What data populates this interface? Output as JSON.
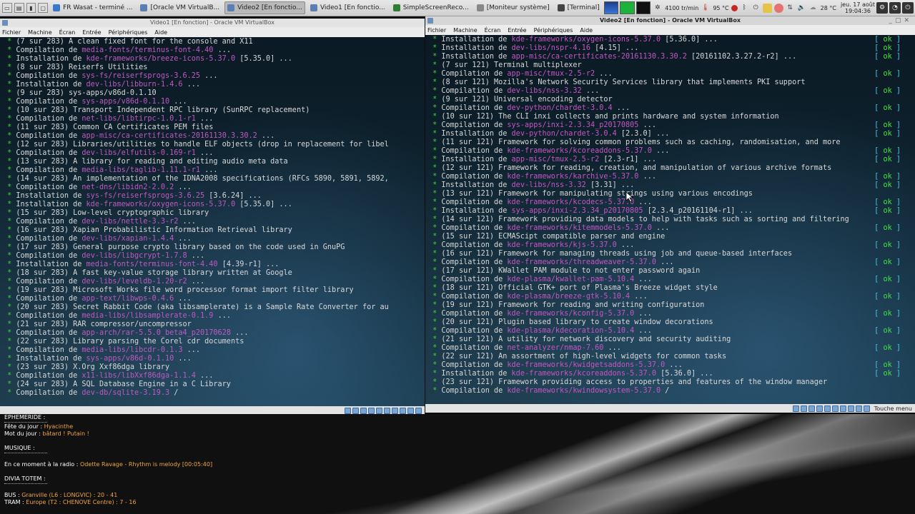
{
  "taskbar": {
    "tasks": [
      {
        "label": "FR Wasat - terminé ...",
        "color": "#3a77c9",
        "active": false
      },
      {
        "label": "[Oracle VM VirtualB...",
        "color": "#5a7fb0",
        "active": false
      },
      {
        "label": "Video2 [En fonctio...",
        "color": "#5a7fb0",
        "active": true
      },
      {
        "label": "Video1 [En fonctio...",
        "color": "#5a7fb0",
        "active": false
      },
      {
        "label": "SimpleScreenReco...",
        "color": "#2e7d32",
        "active": false
      },
      {
        "label": "[Moniteur système]",
        "color": "#888888",
        "active": false
      },
      {
        "label": "[Terminal]",
        "color": "#444444",
        "active": false
      }
    ],
    "fan": "4100 tr/min",
    "temp1": "95 °C",
    "temp2": "28 °C",
    "clock_date": "jeu. 17 août",
    "clock_time": "19:04:36"
  },
  "vm_left": {
    "title": "Video1 [En fonction] - Oracle VM VirtualBox",
    "menu": [
      "Fichier",
      "Machine",
      "Écran",
      "Entrée",
      "Périphériques",
      "Aide"
    ],
    "lines": [
      {
        "t": "desc",
        "text": "(7 sur 283) A clean fixed font for the console and X11"
      },
      {
        "t": "pkg",
        "verb": "Compilation de ",
        "pkg": "media-fonts/terminus-font-4.40",
        "rest": " ..."
      },
      {
        "t": "pkg",
        "verb": "Installation de ",
        "pkg": "kde-frameworks/breeze-icons-5.37.0",
        "rest": " [5.35.0] ..."
      },
      {
        "t": "desc",
        "text": "(8 sur 283) Reiserfs Utilities"
      },
      {
        "t": "pkg",
        "verb": "Compilation de ",
        "pkg": "sys-fs/reiserfsprogs-3.6.25",
        "rest": " ..."
      },
      {
        "t": "pkg",
        "verb": "Installation de ",
        "pkg": "dev-libs/libburn-1.4.6",
        "rest": " ..."
      },
      {
        "t": "desc",
        "text": "(9 sur 283) sys-apps/v86d-0.1.10"
      },
      {
        "t": "pkg",
        "verb": "Compilation de ",
        "pkg": "sys-apps/v86d-0.1.10",
        "rest": " ..."
      },
      {
        "t": "desc",
        "text": "(10 sur 283) Transport Independent RPC library (SunRPC replacement)"
      },
      {
        "t": "pkg",
        "verb": "Compilation de ",
        "pkg": "net-libs/libtirpc-1.0.1-r1",
        "rest": " ..."
      },
      {
        "t": "desc",
        "text": "(11 sur 283) Common CA Certificates PEM files"
      },
      {
        "t": "pkg",
        "verb": "Compilation de ",
        "pkg": "app-misc/ca-certificates-20161130.3.30.2",
        "rest": " ..."
      },
      {
        "t": "desc",
        "text": "(12 sur 283) Libraries/utilities to handle ELF objects (drop in replacement for libel"
      },
      {
        "t": "pkg",
        "verb": "Compilation de ",
        "pkg": "dev-libs/elfutils-0.169-r1",
        "rest": " ..."
      },
      {
        "t": "desc",
        "text": "(13 sur 283) A library for reading and editing audio meta data"
      },
      {
        "t": "pkg",
        "verb": "Compilation de ",
        "pkg": "media-libs/taglib-1.11.1-r1",
        "rest": " ..."
      },
      {
        "t": "desc",
        "text": "(14 sur 283) An implementation of the IDNA2008 specifications (RFCs 5890, 5891, 5892,"
      },
      {
        "t": "pkg",
        "verb": "Compilation de ",
        "pkg": "net-dns/libidn2-2.0.2",
        "rest": " ..."
      },
      {
        "t": "pkg",
        "verb": "Installation de ",
        "pkg": "sys-fs/reiserfsprogs-3.6.25",
        "rest": " [3.6.24] ..."
      },
      {
        "t": "pkg",
        "verb": "Installation de ",
        "pkg": "kde-frameworks/oxygen-icons-5.37.0",
        "rest": " [5.35.0] ..."
      },
      {
        "t": "desc",
        "text": "(15 sur 283) Low-level cryptographic library"
      },
      {
        "t": "pkg",
        "verb": "Compilation de ",
        "pkg": "dev-libs/nettle-3.3-r2",
        "rest": " ..."
      },
      {
        "t": "desc",
        "text": "(16 sur 283) Xapian Probabilistic Information Retrieval library"
      },
      {
        "t": "pkg",
        "verb": "Compilation de ",
        "pkg": "dev-libs/xapian-1.4.4",
        "rest": " ..."
      },
      {
        "t": "desc",
        "text": "(17 sur 283) General purpose crypto library based on the code used in GnuPG"
      },
      {
        "t": "pkg",
        "verb": "Compilation de ",
        "pkg": "dev-libs/libgcrypt-1.7.8",
        "rest": " ..."
      },
      {
        "t": "pkg",
        "verb": "Installation de ",
        "pkg": "media-fonts/terminus-font-4.40",
        "rest": " [4.39-r1] ..."
      },
      {
        "t": "desc",
        "text": "(18 sur 283) A fast key-value storage library written at Google"
      },
      {
        "t": "pkg",
        "verb": "Compilation de ",
        "pkg": "dev-libs/leveldb-1.20-r2",
        "rest": " ..."
      },
      {
        "t": "desc",
        "text": "(19 sur 283) Microsoft Works file word processor format import filter library"
      },
      {
        "t": "pkg",
        "verb": "Compilation de ",
        "pkg": "app-text/libwps-0.4.6",
        "rest": " ..."
      },
      {
        "t": "desc",
        "text": "(20 sur 283) Secret Rabbit Code (aka libsamplerate) is a Sample Rate Converter for au"
      },
      {
        "t": "pkg",
        "verb": "Compilation de ",
        "pkg": "media-libs/libsamplerate-0.1.9",
        "rest": " ..."
      },
      {
        "t": "desc",
        "text": "(21 sur 283) RAR compressor/uncompressor"
      },
      {
        "t": "pkg",
        "verb": "Compilation de ",
        "pkg": "app-arch/rar-5.5.0_beta4_p20170628",
        "rest": " ..."
      },
      {
        "t": "desc",
        "text": "(22 sur 283) Library parsing the Corel cdr documents"
      },
      {
        "t": "pkg",
        "verb": "Compilation de ",
        "pkg": "media-libs/libcdr-0.1.3",
        "rest": " ..."
      },
      {
        "t": "pkg",
        "verb": "Installation de ",
        "pkg": "sys-apps/v86d-0.1.10",
        "rest": " ..."
      },
      {
        "t": "desc",
        "text": "(23 sur 283) X.Org Xxf86dga library"
      },
      {
        "t": "pkg",
        "verb": "Compilation de ",
        "pkg": "x11-libs/libXxf86dga-1.1.4",
        "rest": " ..."
      },
      {
        "t": "desc",
        "text": "(24 sur 283) A SQL Database Engine in a C Library"
      },
      {
        "t": "pkg",
        "verb": "Compilation de ",
        "pkg": "dev-db/sqlite-3.19.3",
        "rest": " /"
      }
    ]
  },
  "vm_right": {
    "title": "Video2 [En fonction] - Oracle VM VirtualBox",
    "menu": [
      "Fichier",
      "Machine",
      "Écran",
      "Entrée",
      "Périphériques",
      "Aide"
    ],
    "status_label": "Touche menu",
    "ok_label": "ok",
    "lines": [
      {
        "t": "pkg",
        "verb": "Installation de ",
        "pkg": "kde-frameworks/oxygen-icons-5.37.0",
        "rest": " [5.36.0] ...",
        "ok": true
      },
      {
        "t": "pkg",
        "verb": "Installation de ",
        "pkg": "dev-libs/nspr-4.16",
        "rest": " [4.15] ...",
        "ok": true
      },
      {
        "t": "pkg",
        "verb": "Installation de ",
        "pkg": "app-misc/ca-certificates-20161130.3.30.2",
        "rest": " [20161102.3.27.2-r2] ...",
        "ok": true
      },
      {
        "t": "desc",
        "text": "(7 sur 121) Terminal multiplexer",
        "ok": false
      },
      {
        "t": "pkg",
        "verb": "Compilation de ",
        "pkg": "app-misc/tmux-2.5-r2",
        "rest": " ...",
        "ok": true
      },
      {
        "t": "desc",
        "text": "(8 sur 121) Mozilla's Network Security Services library that implements PKI support",
        "ok": false
      },
      {
        "t": "pkg",
        "verb": "Compilation de ",
        "pkg": "dev-libs/nss-3.32",
        "rest": " ...",
        "ok": true
      },
      {
        "t": "desc",
        "text": "(9 sur 121) Universal encoding detector",
        "ok": false
      },
      {
        "t": "pkg",
        "verb": "Compilation de ",
        "pkg": "dev-python/chardet-3.0.4",
        "rest": " ...",
        "ok": true
      },
      {
        "t": "desc",
        "text": "(10 sur 121) The CLI inxi collects and prints hardware and system information",
        "ok": false
      },
      {
        "t": "pkg",
        "verb": "Compilation de ",
        "pkg": "sys-apps/inxi-2.3.34_p20170805",
        "rest": " ...",
        "ok": true
      },
      {
        "t": "pkg",
        "verb": "Installation de ",
        "pkg": "dev-python/chardet-3.0.4",
        "rest": " [2.3.0] ...",
        "ok": true
      },
      {
        "t": "desc",
        "text": "(11 sur 121) Framework for solving common problems such as caching, randomisation, and more",
        "ok": false
      },
      {
        "t": "pkg",
        "verb": "Compilation de ",
        "pkg": "kde-frameworks/kcoreaddons-5.37.0",
        "rest": " ...",
        "ok": true
      },
      {
        "t": "pkg",
        "verb": "Installation de ",
        "pkg": "app-misc/tmux-2.5-r2",
        "rest": " [2.3-r1] ...",
        "ok": true
      },
      {
        "t": "desc",
        "text": "(12 sur 121) Framework for reading, creation, and manipulation of various archive formats",
        "ok": false
      },
      {
        "t": "pkg",
        "verb": "Compilation de ",
        "pkg": "kde-frameworks/karchive-5.37.0",
        "rest": " ...",
        "ok": true
      },
      {
        "t": "pkg",
        "verb": "Installation de ",
        "pkg": "dev-libs/nss-3.32",
        "rest": " [3.31] ...",
        "ok": true
      },
      {
        "t": "desc",
        "text": "(13 sur 121) Framework for manipulating strings using various encodings",
        "ok": false
      },
      {
        "t": "pkg",
        "verb": "Compilation de ",
        "pkg": "kde-frameworks/kcodecs-5.37.0",
        "rest": " ...",
        "ok": true
      },
      {
        "t": "pkg",
        "verb": "Installation de ",
        "pkg": "sys-apps/inxi-2.3.34_p20170805",
        "rest": " [2.3.4_p20161104-r1] ...",
        "ok": true
      },
      {
        "t": "desc",
        "text": "(14 sur 121) Framework providing data models to help with tasks such as sorting and filtering",
        "ok": false
      },
      {
        "t": "pkg",
        "verb": "Compilation de ",
        "pkg": "kde-frameworks/kitemmodels-5.37.0",
        "rest": " ...",
        "ok": true
      },
      {
        "t": "desc",
        "text": "(15 sur 121) ECMAScipt compatible parser and engine",
        "ok": false
      },
      {
        "t": "pkg",
        "verb": "Compilation de ",
        "pkg": "kde-frameworks/kjs-5.37.0",
        "rest": " ...",
        "ok": true
      },
      {
        "t": "desc",
        "text": "(16 sur 121) Framework for managing threads using job and queue-based interfaces",
        "ok": false
      },
      {
        "t": "pkg",
        "verb": "Compilation de ",
        "pkg": "kde-frameworks/threadweaver-5.37.0",
        "rest": " ...",
        "ok": true
      },
      {
        "t": "desc",
        "text": "(17 sur 121) KWallet PAM module to not enter password again",
        "ok": false
      },
      {
        "t": "pkg",
        "verb": "Compilation de ",
        "pkg": "kde-plasma/kwallet-pam-5.10.4",
        "rest": " ...",
        "ok": true
      },
      {
        "t": "desc",
        "text": "(18 sur 121) Official GTK+ port of Plasma's Breeze widget style",
        "ok": false
      },
      {
        "t": "pkg",
        "verb": "Compilation de ",
        "pkg": "kde-plasma/breeze-gtk-5.10.4",
        "rest": " ...",
        "ok": true
      },
      {
        "t": "desc",
        "text": "(19 sur 121) Framework for reading and writing configuration",
        "ok": false
      },
      {
        "t": "pkg",
        "verb": "Compilation de ",
        "pkg": "kde-frameworks/kconfig-5.37.0",
        "rest": " ...",
        "ok": true
      },
      {
        "t": "desc",
        "text": "(20 sur 121) Plugin based library to create window decorations",
        "ok": false
      },
      {
        "t": "pkg",
        "verb": "Compilation de ",
        "pkg": "kde-plasma/kdecoration-5.10.4",
        "rest": " ...",
        "ok": true
      },
      {
        "t": "desc",
        "text": "(21 sur 121) A utility for network discovery and security auditing",
        "ok": false
      },
      {
        "t": "pkg",
        "verb": "Compilation de ",
        "pkg": "net-analyzer/nmap-7.60",
        "rest": " ...",
        "ok": true
      },
      {
        "t": "desc",
        "text": "(22 sur 121) An assortment of high-level widgets for common tasks",
        "ok": false
      },
      {
        "t": "pkg",
        "verb": "Compilation de ",
        "pkg": "kde-frameworks/kwidgetsaddons-5.37.0",
        "rest": " ...",
        "ok": true
      },
      {
        "t": "pkg",
        "verb": "Installation de ",
        "pkg": "kde-frameworks/kcoreaddons-5.37.0",
        "rest": " [5.36.0] ...",
        "ok": true
      },
      {
        "t": "desc",
        "text": "(23 sur 121) Framework providing access to properties and features of the window manager",
        "ok": false
      },
      {
        "t": "pkg",
        "verb": "Compilation de ",
        "pkg": "kde-frameworks/kwindowsystem-5.37.0",
        "rest": " /",
        "ok": false
      }
    ]
  },
  "conky": {
    "heading_ephemeride": "EPHEMERIDE :",
    "fete_label": "Fête du jour : ",
    "fete_value": "Hyacinthe",
    "mot_label": "Mot du jour : ",
    "mot_value": "bâtard ! Putain !",
    "heading_musique": "MUSIQUE :",
    "radio_label": "En ce moment à la radio : ",
    "radio_value": "Odette Ravage - Rhythm is melody [00:05:40]",
    "heading_divia": "DIVIA TOTEM :",
    "bus_label": "BUS : ",
    "bus_value": "Granville (L6 : LONGVIC) : 20 - 41",
    "tram_label": "TRAM : ",
    "tram_value": "Europe (T2 : CHENOVE Centre) : 7 - 16"
  }
}
